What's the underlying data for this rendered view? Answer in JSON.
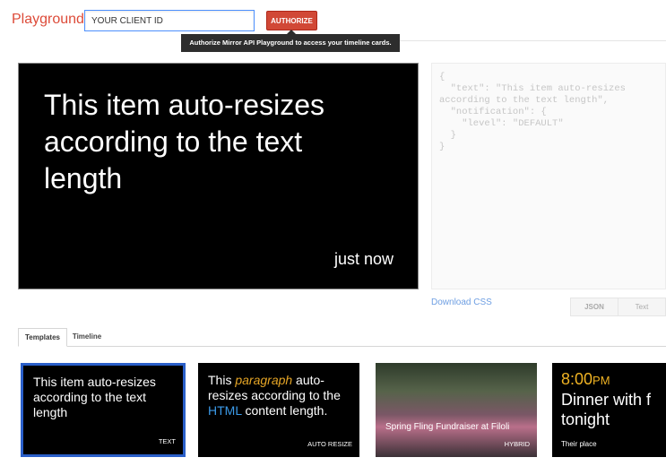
{
  "header": {
    "brand": "Playground",
    "client_id_value": "YOUR CLIENT ID",
    "authorize_label": "AUTHORIZE",
    "tooltip": "Authorize Mirror API Playground to access your timeline cards."
  },
  "card": {
    "text": "This item auto-resizes according to the text length",
    "time": "just now"
  },
  "json_panel": {
    "code": "{\n  \"text\": \"This item auto-resizes\naccording to the text length\",\n  \"notification\": {\n    \"level\": \"DEFAULT\"\n  }\n}"
  },
  "actions": {
    "download_css": "Download CSS",
    "json_label": "JSON",
    "text_label": "Text"
  },
  "tabs": [
    {
      "label": "Templates"
    },
    {
      "label": "Timeline"
    }
  ],
  "templates": [
    {
      "text": "This item auto-resizes according to the text length",
      "tag": "TEXT"
    },
    {
      "text_a": "This ",
      "text_em": "paragraph",
      "text_b": " auto-resizes according to the ",
      "text_blue": "HTML",
      "text_c": " content length.",
      "tag": "AUTO RESIZE"
    },
    {
      "caption": "Spring Fling Fundraiser at Filoli",
      "tag": "HYBRID"
    },
    {
      "time": "8:00",
      "time_suffix": "PM",
      "event_line1": "Dinner with f",
      "event_line2": "tonight",
      "place": "Their place"
    }
  ],
  "colors": {
    "brand": "#dd4b39",
    "authorize": "#d14836",
    "selected_border": "#2a5fc9",
    "accent_orange": "#e5a526",
    "accent_blue": "#3b9ae8"
  }
}
